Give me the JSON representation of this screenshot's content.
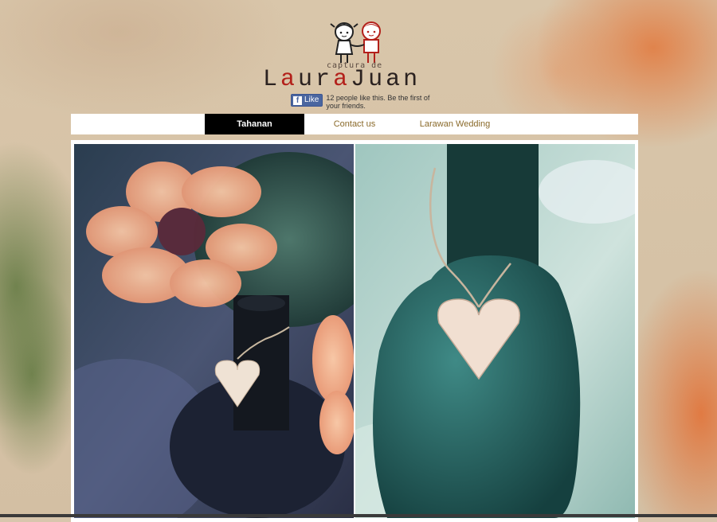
{
  "site": {
    "tagline": "captura de",
    "logo_part1": "Laura",
    "logo_part2": "Juan"
  },
  "facebook": {
    "like_label": "Like",
    "like_text": "12 people like this. Be the first of your friends."
  },
  "nav": {
    "items": [
      {
        "label": "Tahanan",
        "active": true
      },
      {
        "label": "Contact us",
        "active": false
      },
      {
        "label": "Larawan Wedding",
        "active": false
      }
    ]
  },
  "gallery": {
    "photos": [
      {
        "subject": "bottle with heart tag among orange flowers"
      },
      {
        "subject": "green bottle neck with heart tag tied with twine"
      }
    ]
  },
  "colors": {
    "accent_red": "#b3201a",
    "nav_active_bg": "#000000",
    "nav_text": "#8a6a2a",
    "fb_blue": "#4a66a0"
  },
  "icons": [
    "couple-mascot-icon",
    "facebook-f-icon"
  ]
}
